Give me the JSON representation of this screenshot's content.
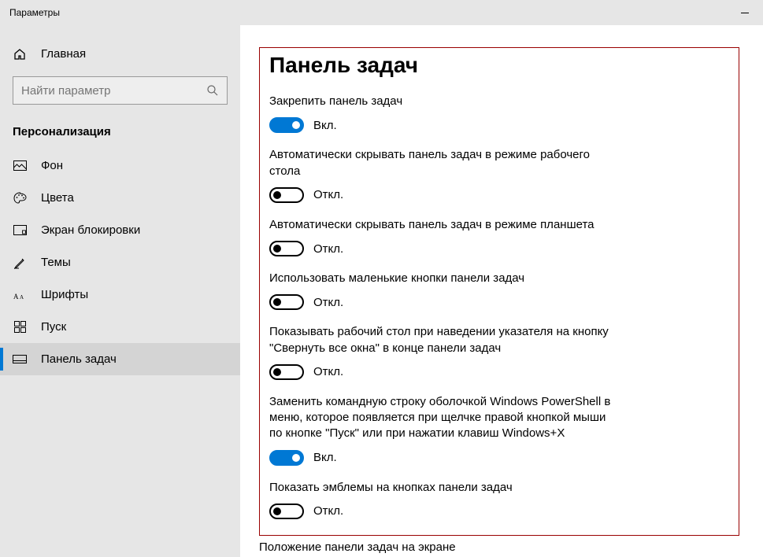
{
  "window": {
    "title": "Параметры"
  },
  "sidebar": {
    "home": "Главная",
    "search_placeholder": "Найти параметр",
    "category": "Персонализация",
    "items": [
      {
        "label": "Фон"
      },
      {
        "label": "Цвета"
      },
      {
        "label": "Экран блокировки"
      },
      {
        "label": "Темы"
      },
      {
        "label": "Шрифты"
      },
      {
        "label": "Пуск"
      },
      {
        "label": "Панель задач"
      }
    ]
  },
  "content": {
    "heading": "Панель задач",
    "settings": [
      {
        "label": "Закрепить панель задач",
        "state": "on",
        "state_text": "Вкл."
      },
      {
        "label": "Автоматически скрывать панель задач в режиме рабочего стола",
        "state": "off",
        "state_text": "Откл."
      },
      {
        "label": "Автоматически скрывать панель задач в режиме планшета",
        "state": "off",
        "state_text": "Откл."
      },
      {
        "label": "Использовать маленькие кнопки панели задач",
        "state": "off",
        "state_text": "Откл."
      },
      {
        "label": "Показывать рабочий стол при наведении указателя на кнопку \"Свернуть все окна\" в конце панели задач",
        "state": "off",
        "state_text": "Откл."
      },
      {
        "label": "Заменить командную строку оболочкой Windows PowerShell в меню, которое появляется при щелчке правой кнопкой мыши по кнопке \"Пуск\" или при нажатии клавиш Windows+X",
        "state": "on",
        "state_text": "Вкл."
      },
      {
        "label": "Показать эмблемы на кнопках панели задач",
        "state": "off",
        "state_text": "Откл."
      }
    ],
    "footer_label": "Положение панели задач на экране"
  }
}
